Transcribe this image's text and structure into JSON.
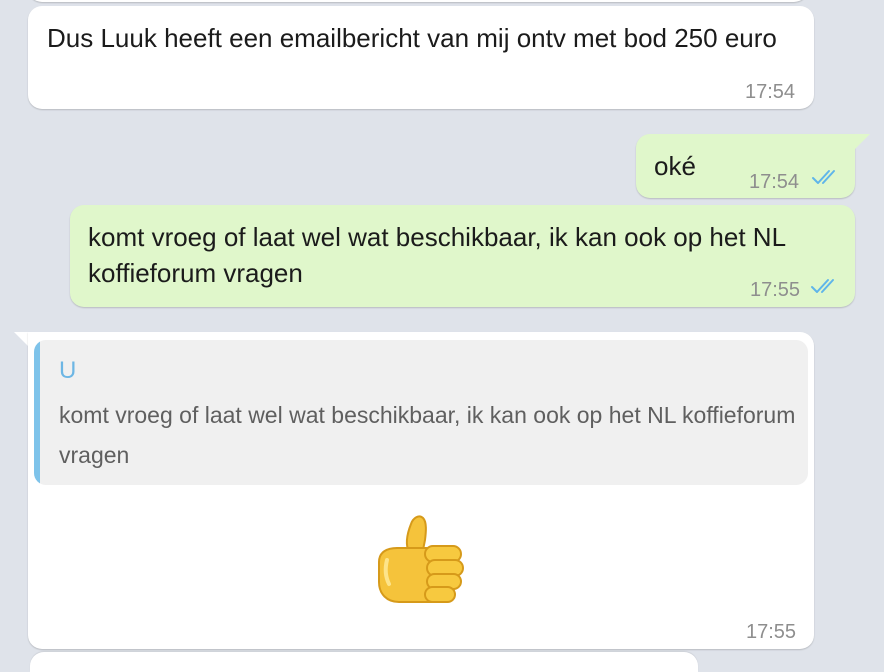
{
  "messages": [
    {
      "id": "m1",
      "direction": "incoming",
      "text": "Dus Luuk heeft een emailbericht van mij ontv met bod 250 euro",
      "time": "17:54"
    },
    {
      "id": "m2",
      "direction": "outgoing",
      "text": "oké",
      "time": "17:54",
      "status": "read"
    },
    {
      "id": "m3",
      "direction": "outgoing",
      "text": "komt vroeg of laat wel wat beschikbaar, ik kan ook op het NL koffieforum vragen",
      "time": "17:55",
      "status": "read"
    },
    {
      "id": "m4",
      "direction": "incoming",
      "reply": {
        "author": "U",
        "text": "komt vroeg of laat wel wat beschikbaar, ik kan ook op het NL koffieforum vragen"
      },
      "emoji": "thumbs-up",
      "time": "17:55"
    }
  ],
  "colors": {
    "background": "#dfe3ea",
    "incoming_bubble": "#ffffff",
    "outgoing_bubble": "#e0f7cb",
    "read_ticks": "#5fb5ea",
    "reply_bar": "#7ec3ea",
    "reply_author": "#6db6e4",
    "timestamp": "#8e8e8e"
  }
}
